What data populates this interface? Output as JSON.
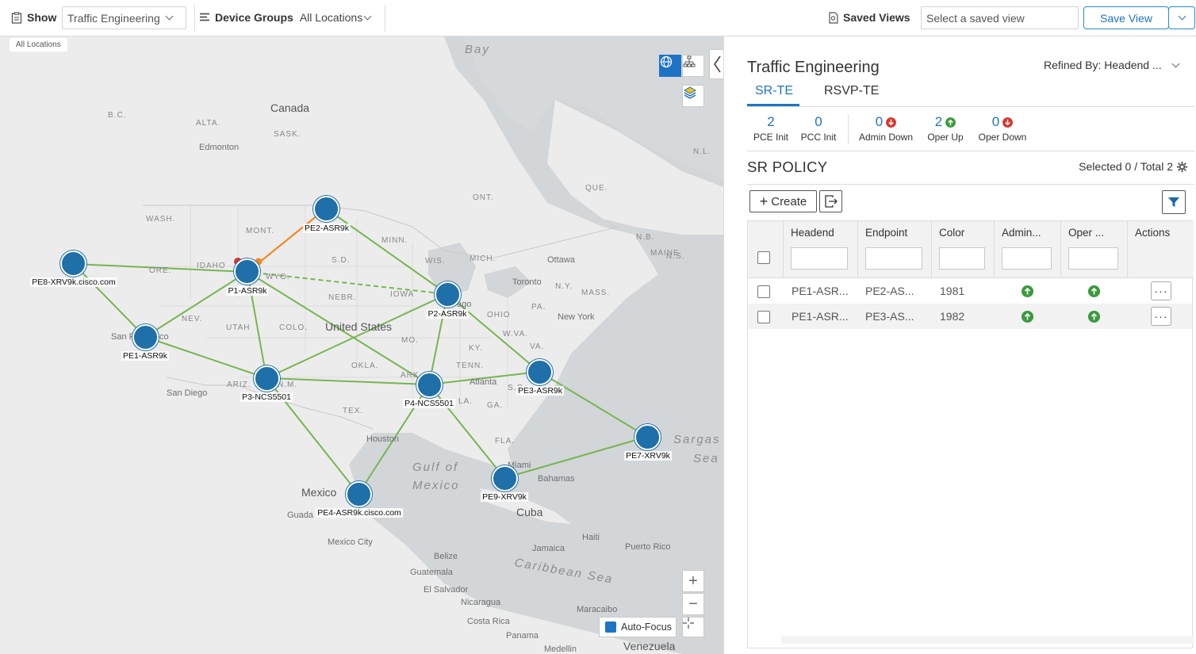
{
  "toolbar": {
    "show_label": "Show",
    "show_value": "Traffic Engineering",
    "device_groups_label": "Device Groups",
    "device_groups_value": "All Locations",
    "saved_views_label": "Saved Views",
    "saved_view_placeholder": "Select a saved view",
    "save_view_label": "Save View"
  },
  "map": {
    "location_badge": "All Locations",
    "places": {
      "bay": "Bay",
      "canada": "Canada",
      "bc": "B.C.",
      "alta": "ALTA.",
      "sask": "SASK.",
      "edmonton": "Edmonton",
      "ont": "ONT.",
      "que": "QUE.",
      "nl": "N.L.",
      "nb": "N.B.",
      "maine": "MAINE",
      "ns": "N.S.",
      "wash": "WASH.",
      "mont": "MONT.",
      "minn": "MINN.",
      "idaho": "IDAHO",
      "ore": "ORE.",
      "wyo": "WYO.",
      "sd": "S.D.",
      "wis": "WIS.",
      "mich": "MICH.",
      "ottawa": "Ottawa",
      "toronto": "Toronto",
      "ny": "N.Y.",
      "mass": "MASS.",
      "nebr": "NEBR.",
      "iowa": "IOWA",
      "pa": "PA.",
      "ohio": "OHIO",
      "nev": "NEV.",
      "utah": "UTAH",
      "colo": "COLO.",
      "united_states": "United States",
      "chicago": "ago",
      "new_york": "New York",
      "wva": "W.VA.",
      "va": "VA.",
      "mo": "MO.",
      "ky": "KY.",
      "okla": "OKLA.",
      "tenn": "TENN.",
      "ariz": "ARIZ.",
      "nm": "N.M.",
      "ark": "ARK.",
      "atlanta": "Atlanta",
      "la": "LA.",
      "ga": "GA.",
      "sc": "S.C.",
      "san_francisco": "San F",
      "sf_tail": "co",
      "san_diego": "San Diego",
      "tex": "TEX.",
      "houston": "Houston",
      "fla": "FLA.",
      "miami": "Miami",
      "bahamas": "Bahamas",
      "gulf1": "Gulf of",
      "gulf2": "Mexico",
      "mexico": "Mexico",
      "guad": "Guada",
      "mexico_city": "Mexico City",
      "cuba": "Cuba",
      "haiti": "Haiti",
      "jamaica": "Jamaica",
      "puerto_rico": "Puerto Rico",
      "belize": "Belize",
      "guatemala": "Guatemala",
      "el_salvador": "El Salvador",
      "nicaragua": "Nicaragua",
      "costa_rica": "Costa Rica",
      "panama": "Panama",
      "caribbean": "Caribbean Sea",
      "maracaibo": "Maracaibo",
      "medellin": "Medellin",
      "venezuela": "Venezuela",
      "sargasso1": "Sargas",
      "sargasso2": "Sea"
    },
    "nodes": [
      {
        "label": "PE2-ASR9k"
      },
      {
        "label": "PE8-XRV9k.cisco.com"
      },
      {
        "label": "P1-ASR9k"
      },
      {
        "label": "P2-ASR9k"
      },
      {
        "label": "PE1-ASR9k"
      },
      {
        "label": "P3-NCS5501"
      },
      {
        "label": "P4-NCS5501"
      },
      {
        "label": "PE3-ASR9k"
      },
      {
        "label": "PE7-XRV9k"
      },
      {
        "label": "PE9-XRV9k"
      },
      {
        "label": "PE4-ASR9k.cisco.com"
      }
    ],
    "auto_focus_label": "Auto-Focus",
    "colors": {
      "link": "#77b552",
      "link_alt": "#f08a24",
      "node": "#1f6fa8"
    }
  },
  "panel": {
    "title": "Traffic Engineering",
    "refined_by": "Refined By: Headend ...",
    "tabs": [
      {
        "label": "SR-TE"
      },
      {
        "label": "RSVP-TE"
      }
    ],
    "stats": [
      {
        "value": "2",
        "label": "PCE Init"
      },
      {
        "value": "0",
        "label": "PCC Init"
      },
      {
        "value": "0",
        "label": "Admin Down"
      },
      {
        "value": "2",
        "label": "Oper Up"
      },
      {
        "value": "0",
        "label": "Oper Down"
      }
    ],
    "section_title": "SR POLICY",
    "selected_total": "Selected 0 / Total 2",
    "create_label": "Create",
    "columns": [
      "Headend",
      "Endpoint",
      "Color",
      "Admin...",
      "Oper ...",
      "Actions"
    ],
    "rows": [
      {
        "headend": "PE1-ASR...",
        "endpoint": "PE2-AS...",
        "color": "1981"
      },
      {
        "headend": "PE1-ASR...",
        "endpoint": "PE3-AS...",
        "color": "1982"
      }
    ],
    "actions_glyph": "···"
  }
}
